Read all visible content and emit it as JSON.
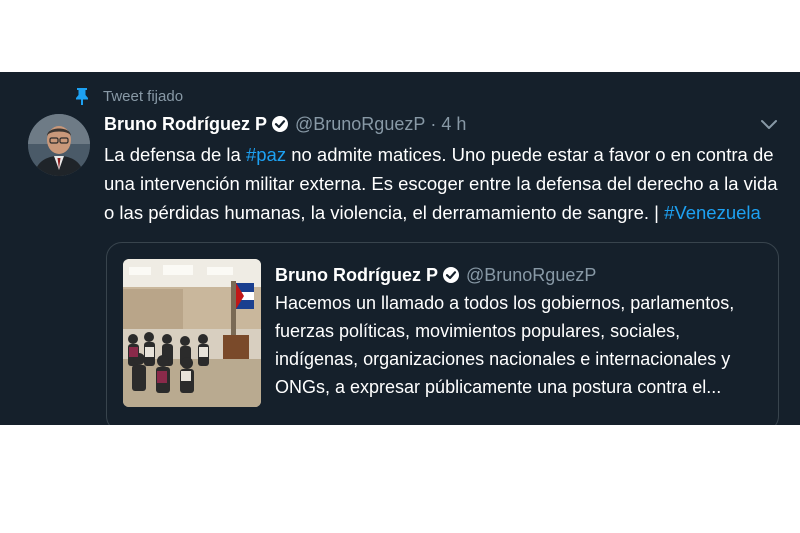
{
  "pinned_label": "Tweet fijado",
  "tweet": {
    "author_name": "Bruno Rodríguez P",
    "handle": "@BrunoRguezP",
    "separator": "·",
    "time": "4 h",
    "line1_a": "La defensa de la ",
    "hashtag_paz": "#paz",
    "line1_b": " no admite matices. Uno puede estar a favor o en contra de",
    "line2": "una intervención militar externa. Es escoger entre la defensa del derecho a la vida",
    "line3_a": "o las pérdidas humanas, la violencia, el derramamiento de sangre. | ",
    "hashtag_venezuela": "#Venezuela"
  },
  "quoted": {
    "author_name": "Bruno Rodríguez P",
    "handle": "@BrunoRguezP",
    "lines": [
      "Hacemos un llamado a todos los gobiernos, parlamentos,",
      "fuerzas políticas, movimientos populares, sociales,",
      "indígenas, organizaciones nacionales e internacionales y",
      "ONGs, a expresar públicamente una postura contra el..."
    ]
  },
  "colors": {
    "background": "#15202b",
    "accent": "#1da1f2",
    "secondary_text": "#8899a6",
    "border": "#38444d"
  },
  "icons": [
    "pin-icon",
    "verified-badge-icon",
    "chevron-down-icon"
  ]
}
